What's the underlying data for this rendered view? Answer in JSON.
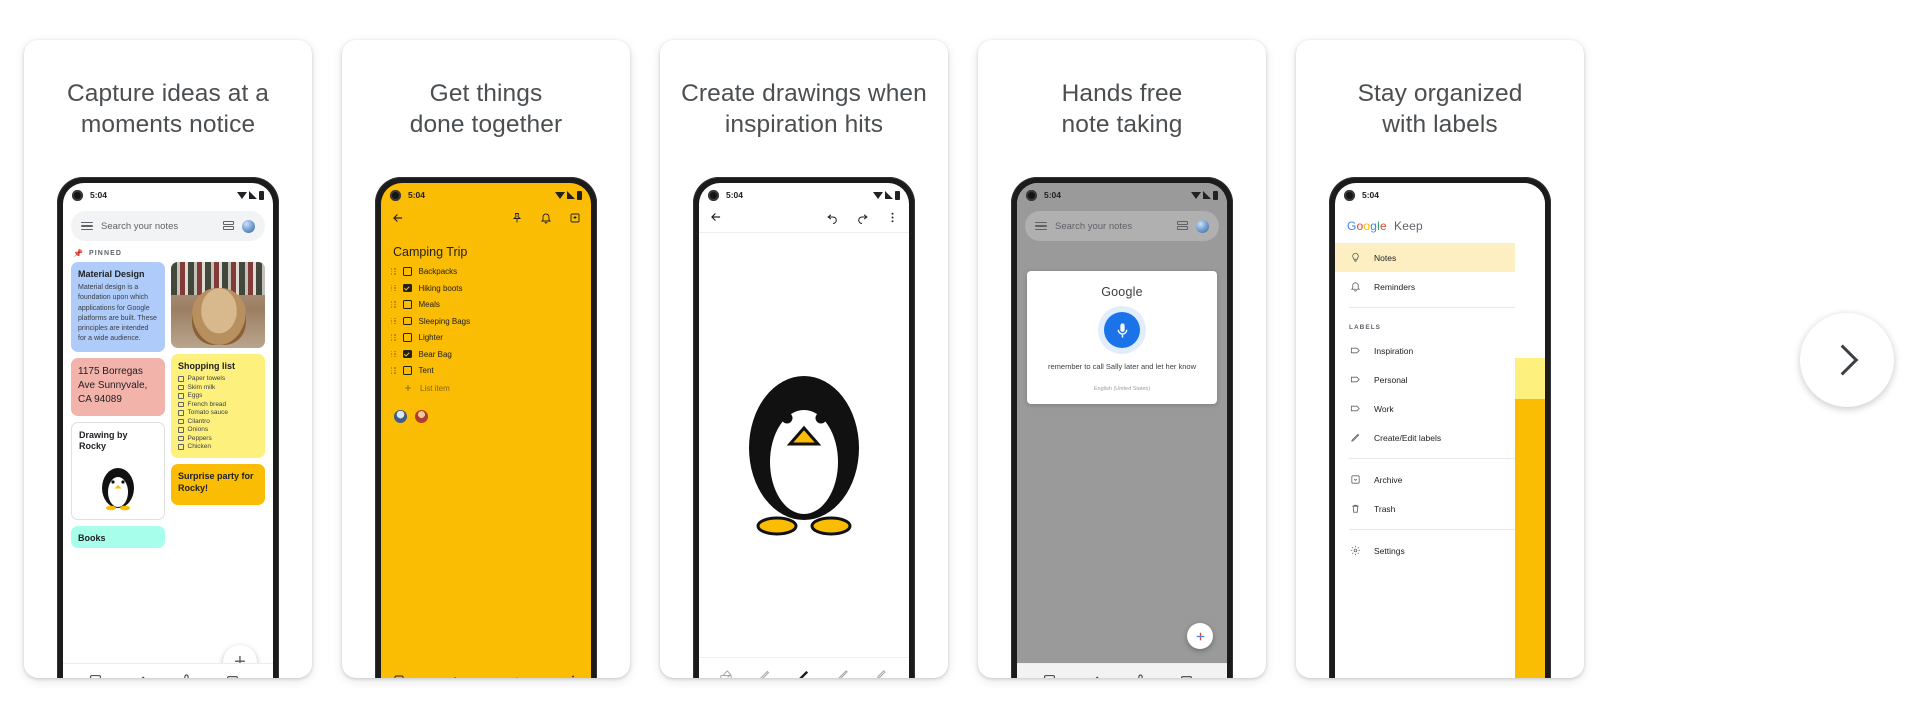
{
  "carousel": {
    "next_button_label": "Next",
    "slides": [
      {
        "title": "Capture ideas at a\nmoments notice",
        "phone": {
          "status_time": "5:04",
          "search_placeholder": "Search your notes",
          "pinned_label": "PINNED",
          "notes": [
            {
              "title": "Material Design",
              "body": "Material design is a foundation upon which applications for Google platforms are built. These principles are intended for a wide audience.",
              "color": "#aecbfa"
            },
            {
              "title": "1175 Borregas Ave Sunnyvale, CA 94089",
              "color": "#f2b3ab"
            },
            {
              "title": "Drawing by Rocky",
              "color": "#ffffff"
            },
            {
              "title": "Books",
              "color": "#a7ffeb"
            },
            {
              "title": "Shopping list",
              "color": "#fdf07c",
              "items": [
                "Paper towels",
                "Skim milk",
                "Eggs",
                "French bread",
                "Tomato sauce",
                "Cilantro",
                "Onions",
                "Peppers",
                "Chicken"
              ]
            },
            {
              "title": "Surprise party for Rocky!",
              "color": "#fbbc04"
            }
          ],
          "toolbar": [
            "checkbox-icon",
            "brush-icon",
            "mic-icon",
            "image-icon"
          ],
          "fab_label": "+"
        }
      },
      {
        "title": "Get things\ndone together",
        "phone": {
          "status_time": "5:04",
          "note_title": "Camping Trip",
          "top_actions": [
            "back-arrow-icon",
            "pin-icon",
            "bell-icon",
            "archive-icon"
          ],
          "checklist": [
            {
              "label": "Backpacks",
              "checked": false
            },
            {
              "label": "Hiking boots",
              "checked": true
            },
            {
              "label": "Meals",
              "checked": false
            },
            {
              "label": "Sleeping Bags",
              "checked": false
            },
            {
              "label": "Lighter",
              "checked": false
            },
            {
              "label": "Bear Bag",
              "checked": true
            },
            {
              "label": "Tent",
              "checked": false
            }
          ],
          "add_item_label": "List item",
          "collaborators": 2,
          "bottom_actions": [
            "add-box-icon",
            "undo-icon",
            "redo-icon",
            "more-vert-icon"
          ]
        }
      },
      {
        "title": "Create drawings when\ninspiration hits",
        "phone": {
          "status_time": "5:04",
          "top_actions": [
            "back-arrow-icon",
            "undo-icon",
            "redo-icon",
            "more-vert-icon"
          ],
          "drawing": "penguin",
          "tools": [
            "eraser-icon",
            "marker-icon",
            "pen-icon",
            "pencil-icon",
            "highlighter-icon"
          ],
          "active_tool_index": 2
        }
      },
      {
        "title": "Hands free\nnote taking",
        "phone": {
          "status_time": "5:04",
          "search_placeholder": "Search your notes",
          "voice_card": {
            "brand": "Google",
            "transcript": "remember to call Sally later and let her know",
            "language": "English (United States)"
          },
          "toolbar": [
            "checkbox-icon",
            "brush-icon",
            "mic-icon",
            "image-icon"
          ],
          "fab_label": "+"
        }
      },
      {
        "title": "Stay organized\nwith labels",
        "phone": {
          "status_time": "5:04",
          "app_name": "Google Keep",
          "nav": [
            {
              "label": "Notes",
              "icon": "bulb-icon",
              "selected": true
            },
            {
              "label": "Reminders",
              "icon": "bell-icon",
              "selected": false
            }
          ],
          "labels_header": "LABELS",
          "labels": [
            {
              "label": "Inspiration",
              "icon": "label-icon"
            },
            {
              "label": "Personal",
              "icon": "label-icon"
            },
            {
              "label": "Work",
              "icon": "label-icon"
            },
            {
              "label": "Create/Edit labels",
              "icon": "pencil-icon"
            }
          ],
          "footer": [
            {
              "label": "Archive",
              "icon": "archive-icon"
            },
            {
              "label": "Trash",
              "icon": "trash-icon"
            },
            {
              "label": "Settings",
              "icon": "gear-icon"
            }
          ]
        }
      }
    ]
  }
}
